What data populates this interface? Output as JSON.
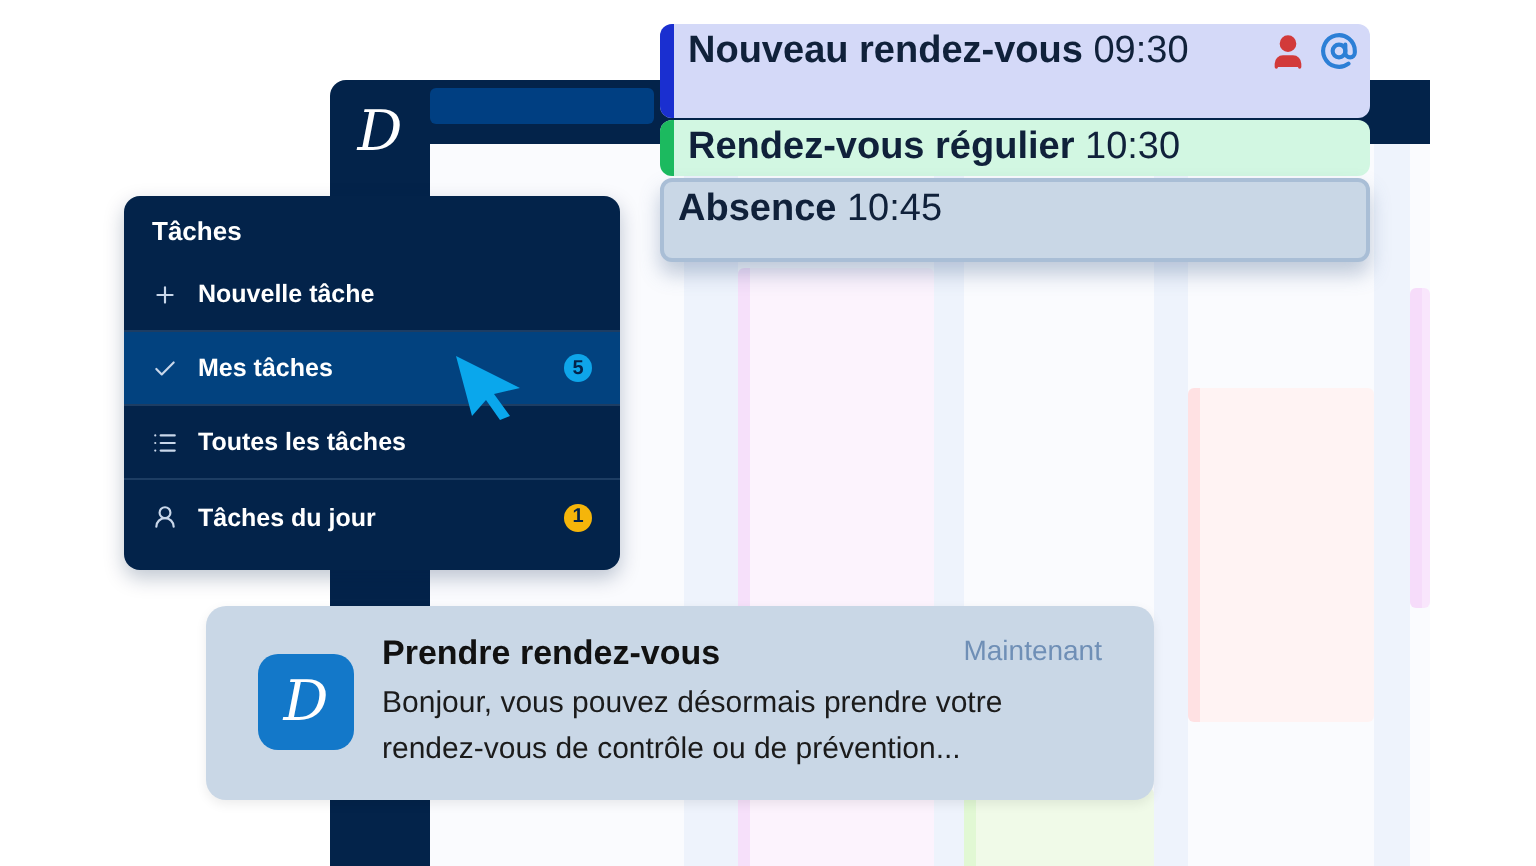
{
  "app_window": {
    "logo": "D"
  },
  "appointments": [
    {
      "kind": "new",
      "title": "Nouveau rendez-vous",
      "time": "09:30",
      "color": "#1a2fd0"
    },
    {
      "kind": "regular",
      "title": "Rendez-vous régulier",
      "time": "10:30",
      "color": "#1cba5f"
    },
    {
      "kind": "absence",
      "title": "Absence",
      "time": "10:45"
    }
  ],
  "tasks_menu": {
    "title": "Tâches",
    "items": [
      {
        "kind": "plus",
        "label": "Nouvelle tâche",
        "selected": false
      },
      {
        "kind": "check",
        "label": "Mes tâches",
        "selected": true,
        "badge": "5",
        "color": "#0ea5e9"
      },
      {
        "kind": "list",
        "label": "Toutes les tâches",
        "selected": false
      },
      {
        "kind": "person",
        "label": "Tâches du jour",
        "selected": false,
        "badge": "1",
        "color": "#f5b50a"
      }
    ]
  },
  "notification": {
    "logo": "D",
    "title": "Prendre rendez-vous",
    "time": "Maintenant",
    "body": "Bonjour, vous pouvez désormais prendre votre rendez-vous de contrôle ou de prévention..."
  }
}
